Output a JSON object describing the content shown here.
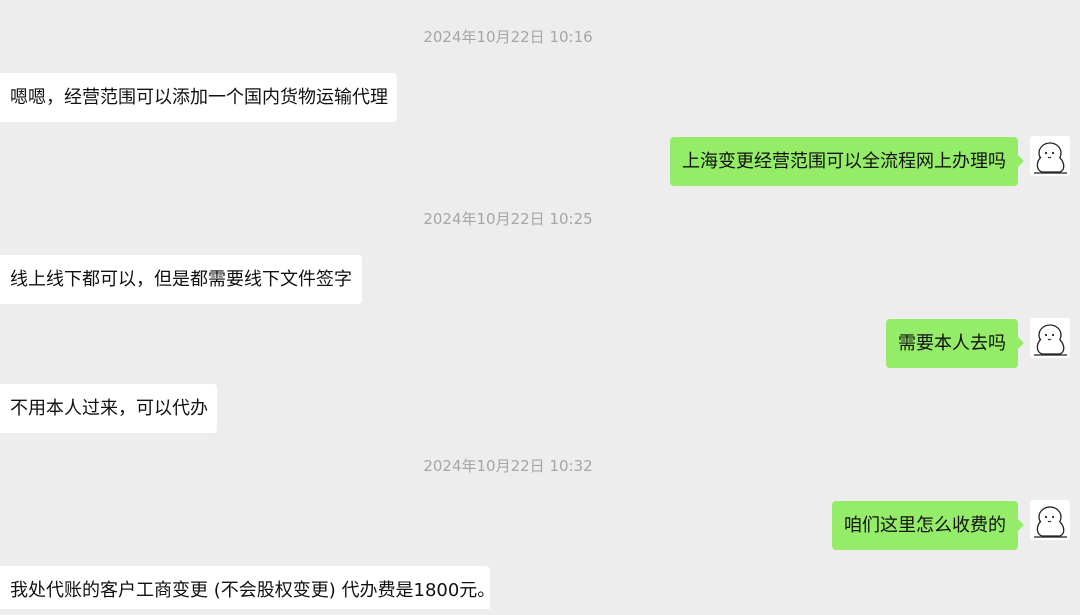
{
  "messages": [
    {
      "type": "time",
      "text": "2024年10月22日 10:16"
    },
    {
      "type": "incoming",
      "text": "嗯嗯，经营范围可以添加一个国内货物运输代理"
    },
    {
      "type": "outgoing",
      "text": "上海变更经营范围可以全流程网上办理吗",
      "avatar_icon": "cartoon-avatar-icon"
    },
    {
      "type": "time",
      "text": "2024年10月22日 10:25"
    },
    {
      "type": "incoming",
      "text": "线上线下都可以，但是都需要线下文件签字"
    },
    {
      "type": "outgoing",
      "text": "需要本人去吗",
      "avatar_icon": "cartoon-avatar-icon"
    },
    {
      "type": "incoming",
      "text": "不用本人过来，可以代办"
    },
    {
      "type": "time",
      "text": "2024年10月22日 10:32"
    },
    {
      "type": "outgoing",
      "text": "咱们这里怎么收费的",
      "avatar_icon": "cartoon-avatar-icon"
    },
    {
      "type": "incoming",
      "text": "我处代账的客户工商变更 (不会股权变更) 代办费是1800元。"
    }
  ],
  "colors": {
    "background": "#ededed",
    "incoming_bubble": "#ffffff",
    "outgoing_bubble": "#95ec69",
    "timestamp_text": "#a6a6a6",
    "message_text": "#111111"
  }
}
